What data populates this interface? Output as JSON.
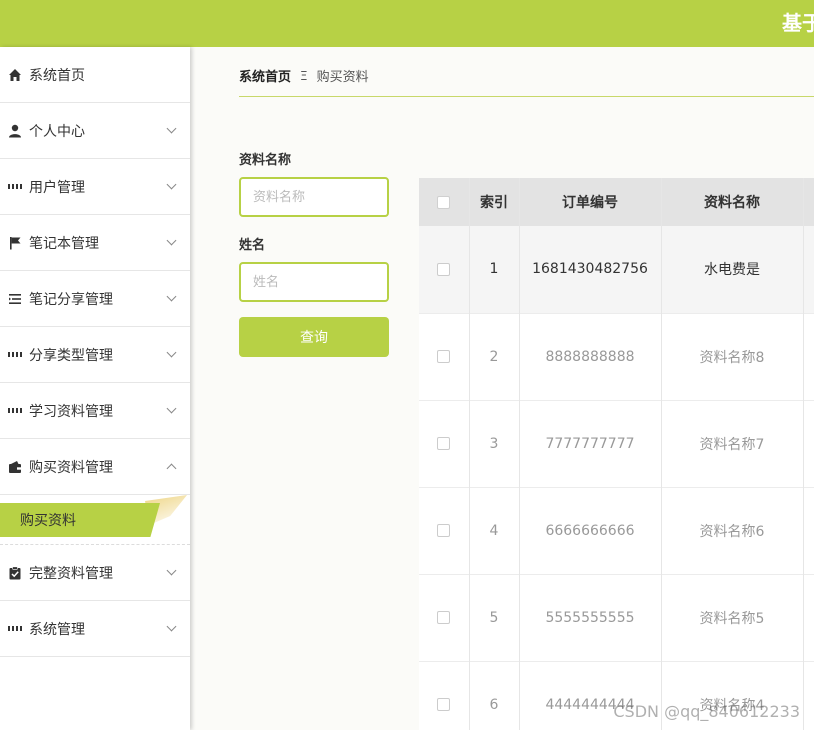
{
  "header": {
    "title": "基于"
  },
  "sidebar": {
    "items": [
      {
        "label": "系统首页",
        "icon": "home-icon"
      },
      {
        "label": "个人中心",
        "icon": "user-icon"
      },
      {
        "label": "用户管理",
        "icon": "grid-icon"
      },
      {
        "label": "笔记本管理",
        "icon": "flag-icon"
      },
      {
        "label": "笔记分享管理",
        "icon": "list-icon"
      },
      {
        "label": "分享类型管理",
        "icon": "grid-icon"
      },
      {
        "label": "学习资料管理",
        "icon": "grid-icon"
      },
      {
        "label": "购买资料管理",
        "icon": "wallet-icon",
        "expanded": true
      },
      {
        "label": "完整资料管理",
        "icon": "clipboard-icon"
      },
      {
        "label": "系统管理",
        "icon": "grid-icon"
      }
    ],
    "submenu_active": "购买资料"
  },
  "breadcrumb": {
    "home": "系统首页",
    "separator": "Ξ",
    "current": "购买资料"
  },
  "search": {
    "name_label": "资料名称",
    "name_placeholder": "资料名称",
    "person_label": "姓名",
    "person_placeholder": "姓名",
    "button": "查询"
  },
  "table": {
    "headers": [
      "索引",
      "订单编号",
      "资料名称"
    ],
    "rows": [
      {
        "index": "1",
        "order": "1681430482756",
        "name": "水电费是"
      },
      {
        "index": "2",
        "order": "8888888888",
        "name": "资料名称8"
      },
      {
        "index": "3",
        "order": "7777777777",
        "name": "资料名称7"
      },
      {
        "index": "4",
        "order": "6666666666",
        "name": "资料名称6"
      },
      {
        "index": "5",
        "order": "5555555555",
        "name": "资料名称5"
      },
      {
        "index": "6",
        "order": "4444444444",
        "name": "资料名称4"
      }
    ]
  },
  "watermark": "CSDN @qq_840612233",
  "colors": {
    "accent": "#b7d145"
  }
}
